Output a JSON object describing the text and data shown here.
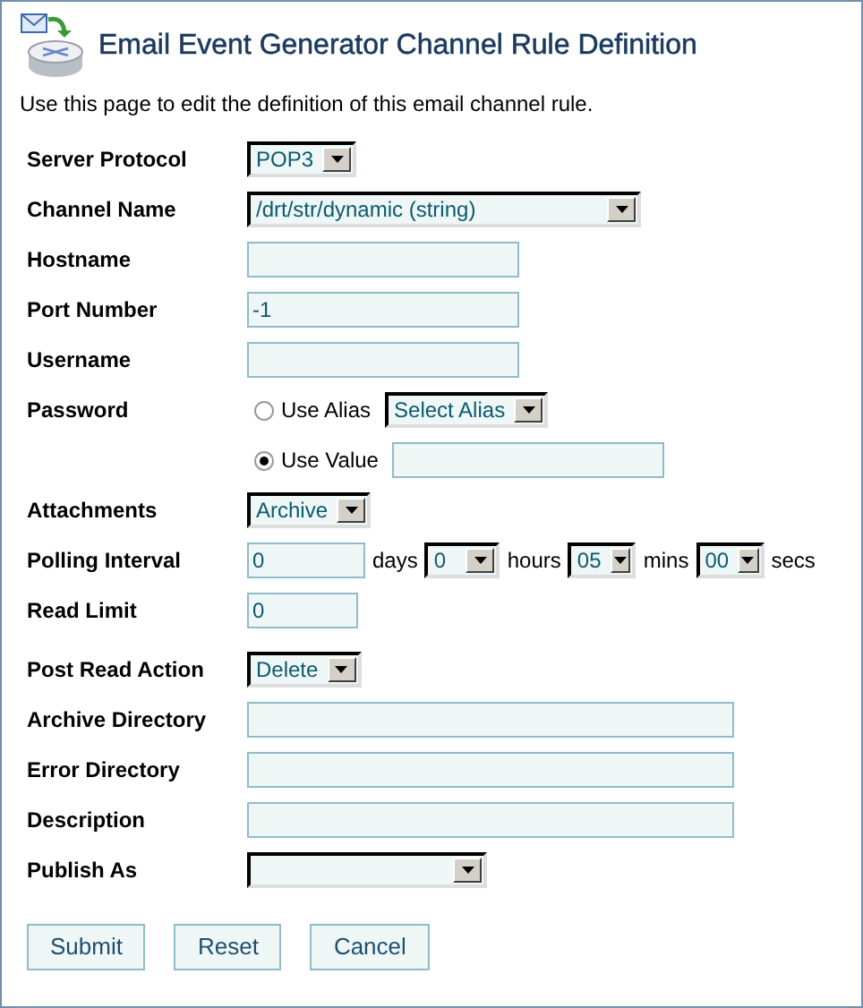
{
  "page": {
    "title": "Email Event Generator Channel Rule Definition",
    "description": "Use this page to edit the definition of this email channel rule."
  },
  "fields": [
    {
      "kind": "select",
      "label": "Server Protocol",
      "value": "POP3"
    },
    {
      "kind": "select",
      "label": "Channel Name",
      "value": "/drt/str/dynamic (string)"
    },
    {
      "kind": "text",
      "label": "Hostname"
    },
    {
      "kind": "text",
      "label": "Port Number",
      "value": "-1"
    },
    {
      "kind": "text",
      "label": "Username"
    },
    {
      "kind": "password",
      "label": "Password",
      "options": [
        {
          "kind": "select",
          "label": "Use Alias",
          "selected": false,
          "select_value": "Select Alias"
        },
        {
          "kind": "input",
          "label": "Use Value",
          "selected": true
        }
      ]
    },
    {
      "kind": "select",
      "label": "Attachments",
      "value": "Archive"
    },
    {
      "kind": "interval",
      "label": "Polling Interval",
      "days": "0",
      "days_unit": "days",
      "hours": "0",
      "hours_unit": "hours",
      "mins": "05",
      "mins_unit": "mins",
      "secs": "00",
      "secs_unit": "secs"
    },
    {
      "kind": "text",
      "label": "Read Limit",
      "value": "0"
    },
    {
      "kind": "select",
      "label": "Post Read Action",
      "value": "Delete"
    },
    {
      "kind": "text",
      "label": "Archive Directory"
    },
    {
      "kind": "text",
      "label": "Error Directory"
    },
    {
      "kind": "text",
      "label": "Description"
    },
    {
      "kind": "select",
      "label": "Publish As"
    }
  ],
  "buttons": [
    "Submit",
    "Reset",
    "Cancel"
  ]
}
